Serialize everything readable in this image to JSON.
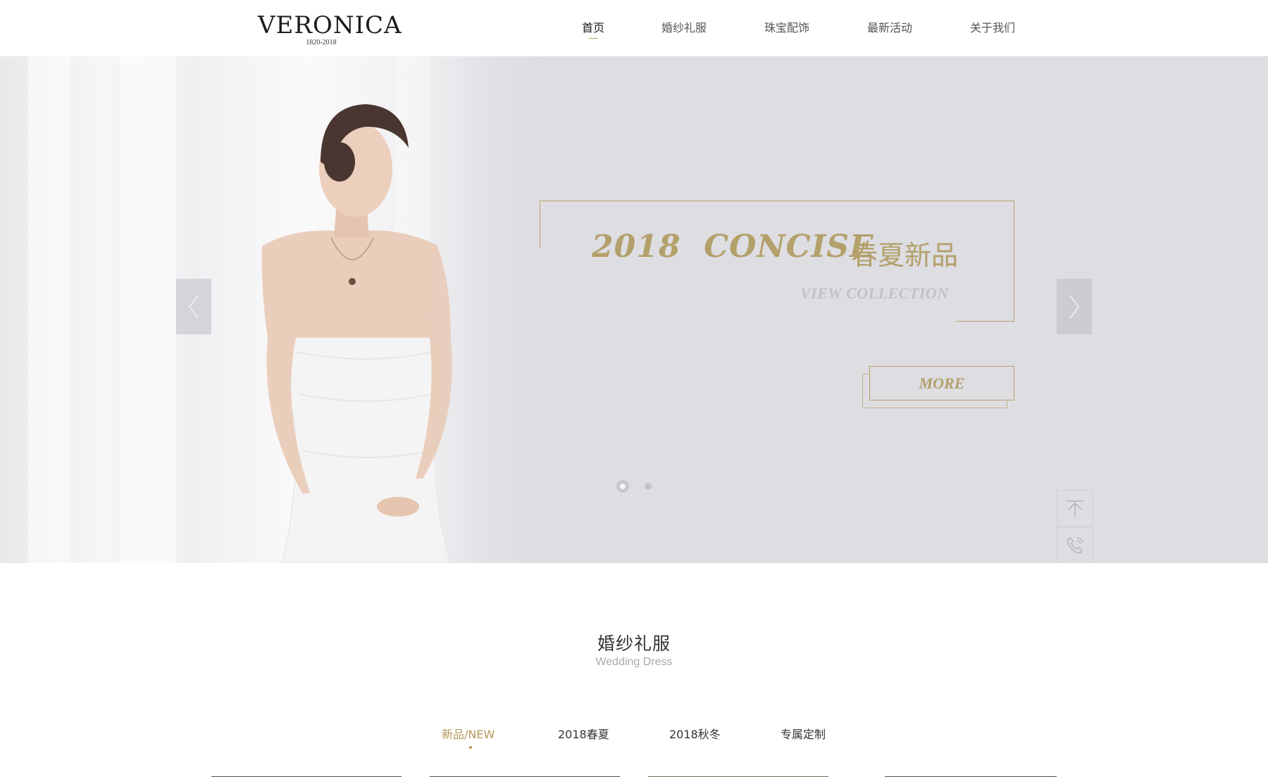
{
  "header": {
    "logo_name": "VERONICA",
    "logo_years": "1820-2018",
    "nav": [
      {
        "label": "首页",
        "active": true
      },
      {
        "label": "婚纱礼服",
        "active": false
      },
      {
        "label": "珠宝配饰",
        "active": false
      },
      {
        "label": "最新活动",
        "active": false
      },
      {
        "label": "关于我们",
        "active": false
      }
    ]
  },
  "banner": {
    "heading": "2018  CONCISE",
    "heading_cn": "春夏新品",
    "subheading": "VIEW COLLECTION",
    "more_label": "MORE",
    "slides_total": 2,
    "slide_active": 1,
    "prev_icon": "chevron-left-icon",
    "next_icon": "chevron-right-icon",
    "accent_color": "#b3a06a",
    "background_color": "#dddde2"
  },
  "floating_tools": {
    "back_to_top_icon": "arrow-up-to-top-icon",
    "phone_icon": "phone-icon"
  },
  "section": {
    "title": "婚纱礼服",
    "subtitle": "Wedding Dress",
    "tabs": [
      {
        "label": "新品/NEW",
        "active": true
      },
      {
        "label": "2018春夏",
        "active": false
      },
      {
        "label": "2018秋冬",
        "active": false
      },
      {
        "label": "专属定制",
        "active": false
      }
    ]
  }
}
